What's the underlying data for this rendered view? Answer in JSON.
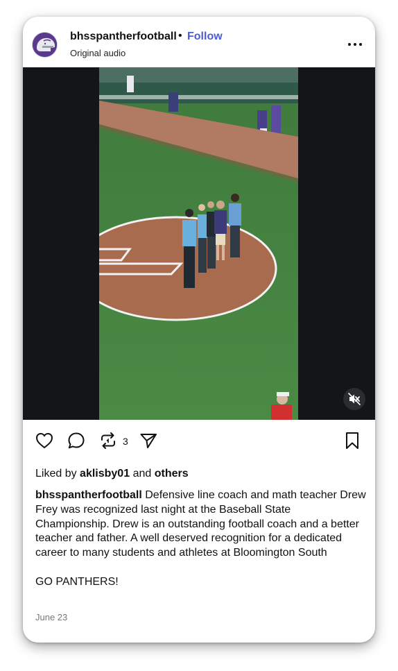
{
  "post": {
    "username": "bhsspantherfootball",
    "separator": "•",
    "follow_label": "Follow",
    "audio_label": "Original audio",
    "more_icon": "more-horizontal-icon",
    "avatar_icon": "panther-helmet-logo"
  },
  "video": {
    "mute_icon": "muted-speaker-icon"
  },
  "actions": {
    "like_icon": "heart-icon",
    "comment_icon": "comment-bubble-icon",
    "repost_icon": "repost-icon",
    "repost_count": "3",
    "share_icon": "send-icon",
    "save_icon": "bookmark-icon"
  },
  "likes": {
    "prefix": "Liked by",
    "user": "aklisby01",
    "joiner": "and",
    "others": "others"
  },
  "caption": {
    "author": "bhsspantherfootball",
    "body": "Defensive line coach and math teacher Drew Frey was recognized last night at the Baseball State Championship. Drew is an outstanding football coach and a better teacher and father. A well deserved recognition for a dedicated career to many students and athletes at Bloomington South",
    "tagline": "GO PANTHERS!"
  },
  "date": "June 23",
  "colors": {
    "follow": "#4a5dd6",
    "video_bg": "#131517",
    "field_grass": "#3f7a3c",
    "infield_dirt": "#a96b4e"
  }
}
